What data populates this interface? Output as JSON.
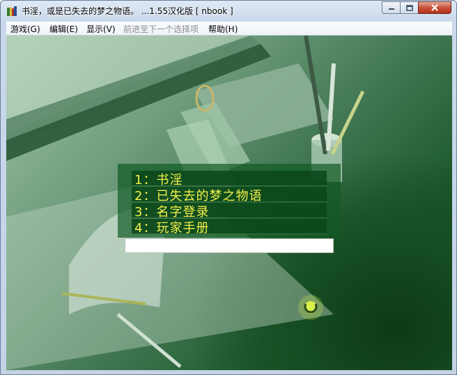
{
  "window": {
    "title": "书淫，或是已失去的梦之物语。 ...1.55汉化版 [ nbook ]",
    "icons": {
      "app": "app-icon",
      "minimize": "minimize-icon",
      "maximize": "maximize-icon",
      "close": "close-icon"
    }
  },
  "menubar": {
    "items": [
      {
        "label": "游戏(G)",
        "enabled": true
      },
      {
        "label": "编辑(E)",
        "enabled": true
      },
      {
        "label": "显示(V)",
        "enabled": true
      },
      {
        "label": "前进至下一个选择项",
        "enabled": false
      },
      {
        "label": "帮助(H)",
        "enabled": true
      }
    ]
  },
  "game": {
    "choices": [
      {
        "label": "1：书淫"
      },
      {
        "label": "2：已失去的梦之物语"
      },
      {
        "label": "3：名字登录"
      },
      {
        "label": "4：玩家手册"
      }
    ],
    "choice_text_color": "#f4f04a",
    "panel_color": "#0f5a23"
  }
}
